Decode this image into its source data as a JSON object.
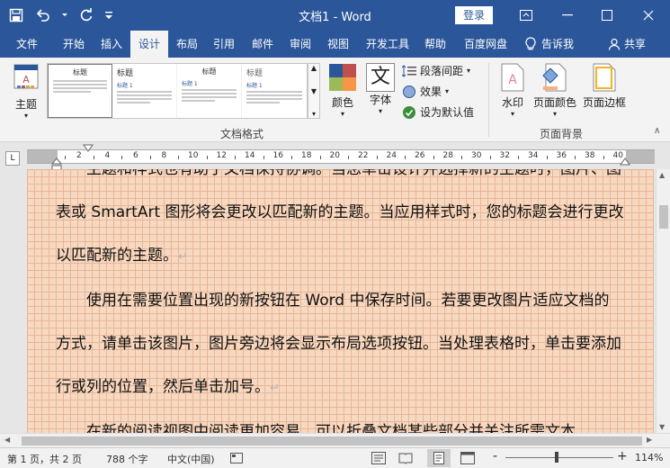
{
  "title_bar": {
    "doc_title": "文档1 - Word",
    "login_label": "登录"
  },
  "tabs": [
    "文件",
    "开始",
    "插入",
    "设计",
    "布局",
    "引用",
    "邮件",
    "审阅",
    "视图",
    "开发工具",
    "帮助",
    "百度网盘"
  ],
  "active_tab": "设计",
  "tell_me": "告诉我",
  "share": "共享",
  "ribbon": {
    "theme_label": "主题",
    "gallery": {
      "items": [
        {
          "title": "标题",
          "heading": ""
        },
        {
          "title": "标题",
          "heading": "标题 1"
        },
        {
          "title": "标题",
          "heading": "标题 1"
        },
        {
          "title": "标题",
          "heading": "标题 1"
        }
      ]
    },
    "colors_label": "颜色",
    "fonts_label": "字体",
    "font_glyph": "文",
    "paragraph_spacing_label": "段落间距",
    "effects_label": "效果",
    "set_default_label": "设为默认值",
    "group_document_format": "文档格式",
    "watermark_label": "水印",
    "page_color_label": "页面颜色",
    "page_borders_label": "页面边框",
    "group_page_background": "页面背景"
  },
  "ruler": {
    "tab_selector": "L",
    "numbers": [
      "2",
      "4",
      "6",
      "8",
      "10",
      "12",
      "14",
      "16",
      "18",
      "20",
      "22",
      "24",
      "26",
      "28",
      "30",
      "32",
      "34",
      "36",
      "38",
      "40"
    ]
  },
  "document": {
    "paragraphs": [
      "主题和样式也有助于文档保持协调。当您单击设计并选择新的主题时，图片、图表或 SmartArt 图形将会更改以匹配新的主题。当应用样式时，您的标题会进行更改以匹配新的主题。",
      "使用在需要位置出现的新按钮在 Word 中保存时间。若要更改图片适应文档的方式，请单击该图片，图片旁边将会显示布局选项按钮。当处理表格时，单击要添加行或列的位置，然后单击加号。",
      "在新的阅读视图中阅读更加容易。可以折叠文档某些部分并关注所需文本。"
    ],
    "paragraph_mark": "↵"
  },
  "status_bar": {
    "page": "第 1 页，共 2 页",
    "words": "788 个字",
    "language": "中文(中国)",
    "zoom_out": "-",
    "zoom_in": "+",
    "zoom": "114%"
  },
  "colors": {
    "accent": "#2b579a",
    "page_background": "#f7d9c2"
  }
}
